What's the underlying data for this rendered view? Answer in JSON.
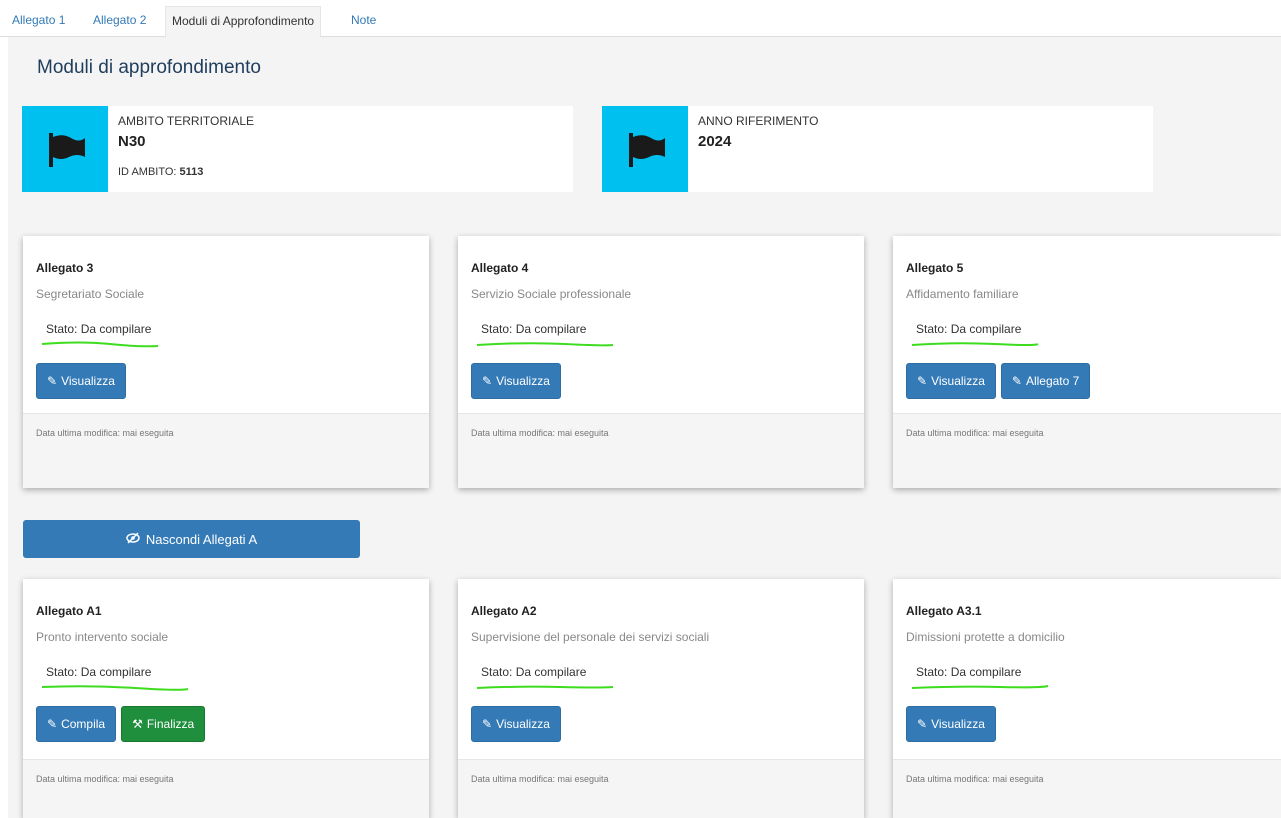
{
  "tabs": [
    {
      "label": "Allegato 1"
    },
    {
      "label": "Allegato 2"
    },
    {
      "label": "Moduli di Approfondimento",
      "active": true
    },
    {
      "label": "Note"
    }
  ],
  "page": {
    "title": "Moduli di approfondimento"
  },
  "info": {
    "ambito": {
      "label": "AMBITO TERRITORIALE",
      "value": "N30",
      "id_label": "ID AMBITO:",
      "id_value": "5113",
      "icon": "flag-icon"
    },
    "anno": {
      "label": "ANNO RIFERIMENTO",
      "value": "2024",
      "icon": "flag-icon"
    }
  },
  "cards": [
    {
      "title": "Allegato 3",
      "subtitle": "Segretariato Sociale",
      "status": "Stato: Da compilare",
      "buttons": [
        {
          "label": "Visualizza",
          "icon": "edit-icon",
          "color": "#337ab7"
        }
      ],
      "footer": "Data ultima modifica: mai eseguita"
    },
    {
      "title": "Allegato 4",
      "subtitle": "Servizio Sociale professionale",
      "status": "Stato: Da compilare",
      "buttons": [
        {
          "label": "Visualizza",
          "icon": "edit-icon",
          "color": "#337ab7"
        }
      ],
      "footer": "Data ultima modifica: mai eseguita"
    },
    {
      "title": "Allegato 5",
      "subtitle": "Affidamento familiare",
      "status": "Stato: Da compilare",
      "buttons": [
        {
          "label": "Visualizza",
          "icon": "edit-icon",
          "color": "#337ab7"
        },
        {
          "label": "Allegato 7",
          "icon": "edit-icon",
          "color": "#337ab7"
        }
      ],
      "footer": "Data ultima modifica: mai eseguita"
    },
    {
      "title": "Allegato A1",
      "subtitle": "Pronto intervento sociale",
      "status": "Stato: Da compilare",
      "buttons": [
        {
          "label": "Compila",
          "icon": "edit-icon",
          "color": "#337ab7"
        },
        {
          "label": "Finalizza",
          "icon": "gavel-icon",
          "color": "#1f8f3e"
        }
      ],
      "footer": "Data ultima modifica: mai eseguita"
    },
    {
      "title": "Allegato A2",
      "subtitle": "Supervisione del personale dei servizi sociali",
      "status": "Stato: Da compilare",
      "buttons": [
        {
          "label": "Visualizza",
          "icon": "edit-icon",
          "color": "#337ab7"
        }
      ],
      "footer": "Data ultima modifica: mai eseguita"
    },
    {
      "title": "Allegato A3.1",
      "subtitle": "Dimissioni protette a domicilio",
      "status": "Stato: Da compilare",
      "buttons": [
        {
          "label": "Visualizza",
          "icon": "edit-icon",
          "color": "#337ab7"
        }
      ],
      "footer": "Data ultima modifica: mai eseguita"
    }
  ],
  "toggle": {
    "label": "Nascondi Allegati A",
    "icon": "eye-slash-icon"
  },
  "colors": {
    "primary": "#337ab7",
    "success": "#1f8f3e",
    "info": "#00c0ef",
    "highlight": "#3ddc1f"
  }
}
